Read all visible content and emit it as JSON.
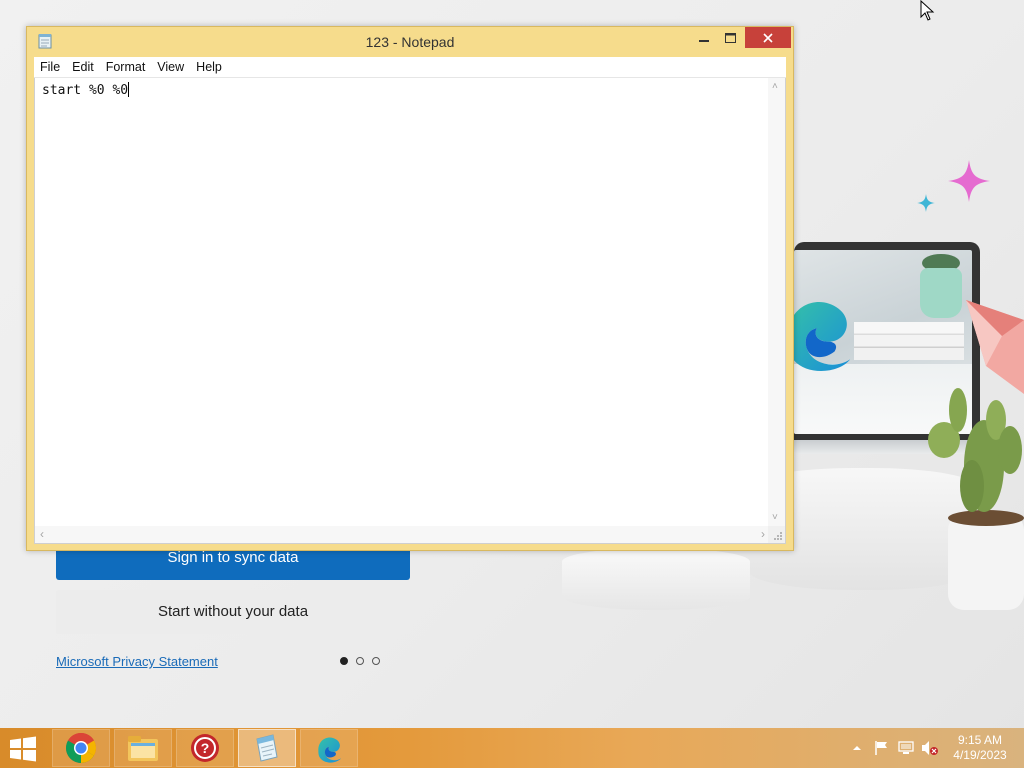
{
  "edge_welcome": {
    "sync_button_label": "Sign in to sync data",
    "no_sync_button_label": "Start without your data",
    "privacy_link_label": "Microsoft Privacy Statement",
    "page_dots": {
      "count": 3,
      "active_index": 0
    }
  },
  "notepad": {
    "title": "123 - Notepad",
    "menu": [
      "File",
      "Edit",
      "Format",
      "View",
      "Help"
    ],
    "content": "start %0 %0",
    "accent_color": "#f6dc8c",
    "close_button_color": "#c7413a"
  },
  "taskbar": {
    "apps": [
      {
        "name": "chrome",
        "icon": "chrome-icon",
        "active": false
      },
      {
        "name": "file-explorer",
        "icon": "folder-icon",
        "active": false
      },
      {
        "name": "help",
        "icon": "help-icon",
        "active": false
      },
      {
        "name": "notepad",
        "icon": "notepad-icon",
        "active": true
      },
      {
        "name": "edge",
        "icon": "edge-icon",
        "active": false
      }
    ],
    "tray_icons": [
      "chevron-up-icon",
      "flag-icon",
      "network-icon",
      "volume-muted-icon"
    ],
    "clock": {
      "time": "9:15 AM",
      "date": "4/19/2023"
    }
  }
}
